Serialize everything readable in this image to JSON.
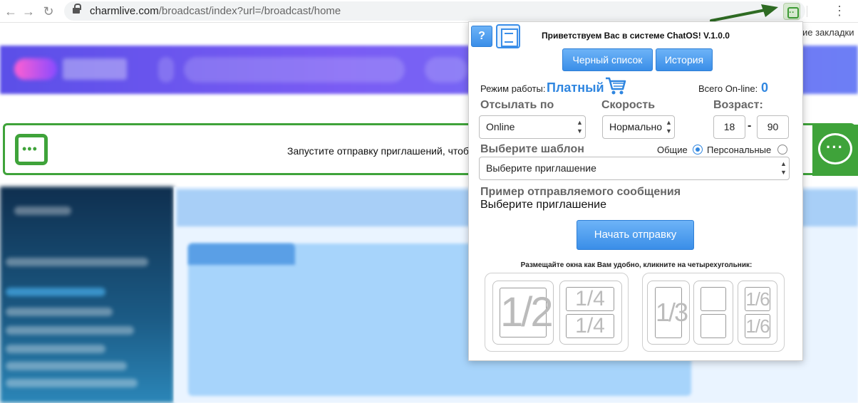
{
  "browser": {
    "url_host": "charmlive.com",
    "url_path": "/broadcast/index?url=/broadcast/home",
    "bookmarks_tail": "ие закладки"
  },
  "site": {
    "notice_text": "Запустите отправку приглашений, чтобы"
  },
  "popup": {
    "help_label": "?",
    "welcome": "Приветствуем Вас в системе ChatOS! V.1.0.0",
    "blacklist_label": "Черный список",
    "history_label": "История",
    "mode_label": "Режим работы:",
    "mode_value": "Платный",
    "online_label": "Всего On-line:",
    "online_value": "0",
    "send_by_label": "Отсылать по",
    "send_by_value": "Online",
    "speed_label": "Скорость",
    "speed_value": "Нормально",
    "age_label": "Возраст:",
    "age_from": "18",
    "age_dash": "-",
    "age_to": "90",
    "template_label": "Выберите шаблон",
    "radio_common": "Общие",
    "radio_personal": "Персональные",
    "template_value": "Выберите приглашение",
    "example_label": "Пример отправляемого сообщения",
    "example_text": "Выберите приглашение",
    "start_label": "Начать отправку",
    "layout_hint": "Размещайте окна как Вам удобно, кликните на четырехугольник:",
    "layouts": {
      "half": "1/2",
      "quarter_top": "1/4",
      "quarter_bottom": "1/4",
      "third": "1/3",
      "sixth_top": "1/6",
      "sixth_bottom": "1/6"
    },
    "accent_color": "#2f86e0"
  }
}
